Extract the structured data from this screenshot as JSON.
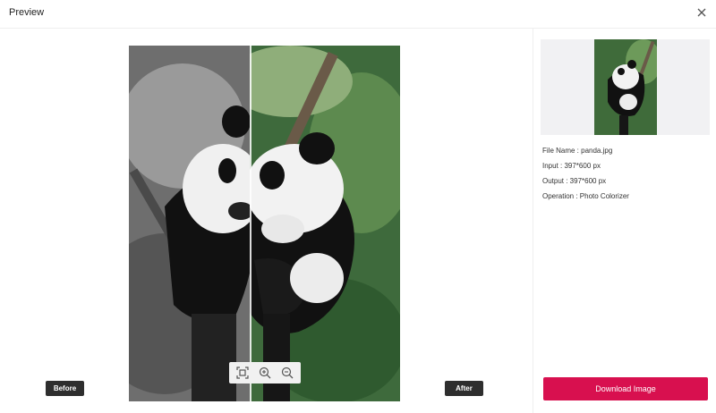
{
  "header": {
    "title": "Preview",
    "close_icon": "close-icon"
  },
  "preview": {
    "before_label": "Before",
    "after_label": "After",
    "tools": [
      {
        "name": "fit-screen-icon"
      },
      {
        "name": "zoom-in-icon"
      },
      {
        "name": "zoom-out-icon"
      }
    ]
  },
  "details": {
    "file_name": "File Name : panda.jpg",
    "input": "Input : 397*600 px",
    "output": "Output : 397*600 px",
    "operation": "Operation : Photo Colorizer"
  },
  "actions": {
    "download_label": "Download Image"
  },
  "colors": {
    "accent": "#d8104f",
    "pill_bg": "#2e2e2e",
    "thumb_bg": "#f1f1f3"
  }
}
